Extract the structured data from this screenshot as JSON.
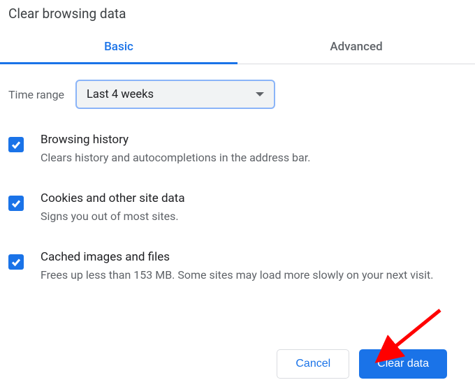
{
  "title": "Clear browsing data",
  "tabs": {
    "basic": "Basic",
    "advanced": "Advanced"
  },
  "time_range": {
    "label": "Time range",
    "selected": "Last 4 weeks"
  },
  "options": [
    {
      "title": "Browsing history",
      "desc": "Clears history and autocompletions in the address bar."
    },
    {
      "title": "Cookies and other site data",
      "desc": "Signs you out of most sites."
    },
    {
      "title": "Cached images and files",
      "desc": "Frees up less than 153 MB. Some sites may load more slowly on your next visit."
    }
  ],
  "buttons": {
    "cancel": "Cancel",
    "clear": "Clear data"
  },
  "colors": {
    "accent": "#1a73e8",
    "annotation": "#ff0000"
  }
}
